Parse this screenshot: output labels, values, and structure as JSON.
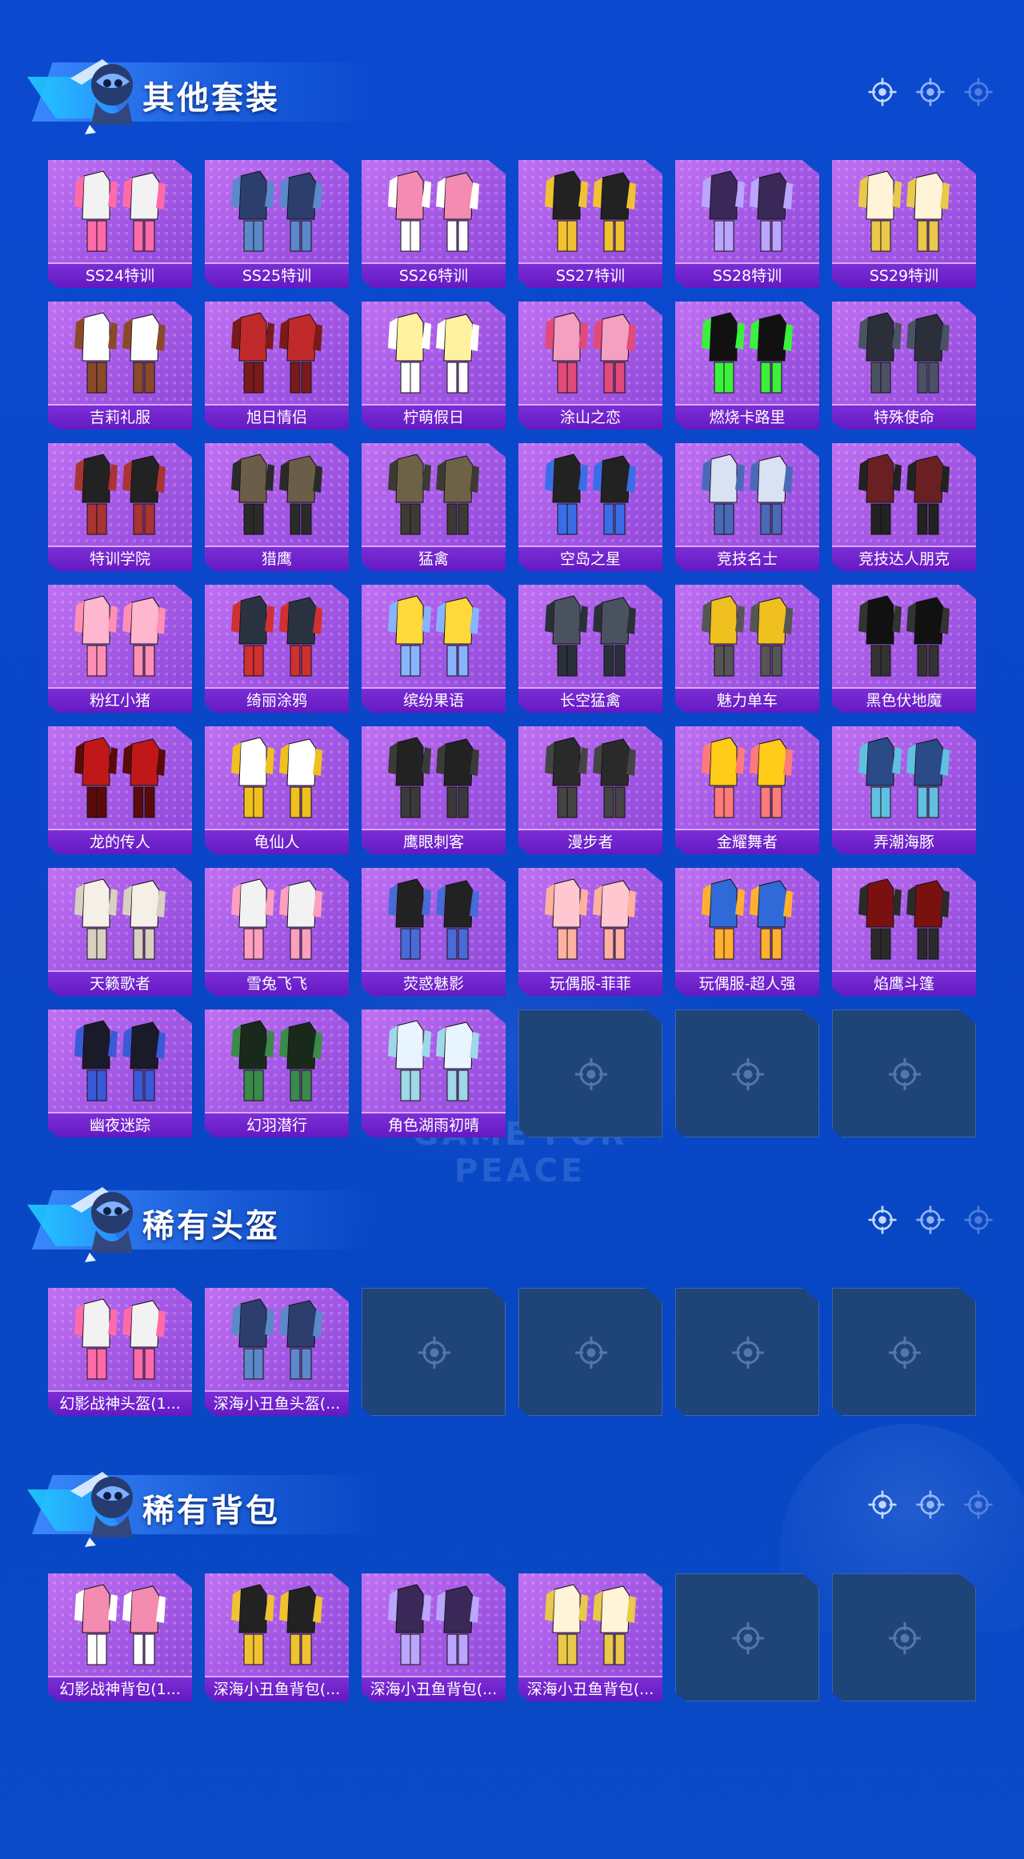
{
  "watermark": "GAME FOR PEACE",
  "sections": [
    {
      "title": "其他套装",
      "items": [
        "SS24特训",
        "SS25特训",
        "SS26特训",
        "SS27特训",
        "SS28特训",
        "SS29特训",
        "吉莉礼服",
        "旭日情侣",
        "柠萌假日",
        "涂山之恋",
        "燃烧卡路里",
        "特殊使命",
        "特训学院",
        "猎鹰",
        "猛禽",
        "空岛之星",
        "竞技名士",
        "竞技达人朋克",
        "粉红小猪",
        "绮丽涂鸦",
        "缤纷果语",
        "长空猛禽",
        "魅力单车",
        "黑色伏地魔",
        "龙的传人",
        "龟仙人",
        "鹰眼刺客",
        "漫步者",
        "金耀舞者",
        "弄潮海豚",
        "天籁歌者",
        "雪兔飞飞",
        "荧惑魅影",
        "玩偶服-菲菲",
        "玩偶服-超人强",
        "焰鹰斗篷",
        "幽夜迷踪",
        "幻羽潜行",
        "角色湖雨初晴"
      ],
      "empty_slots": 3
    },
    {
      "title": "稀有头盔",
      "items": [
        "幻影战神头盔(1...",
        "深海小丑鱼头盔(..."
      ],
      "empty_slots": 4
    },
    {
      "title": "稀有背包",
      "items": [
        "幻影战神背包(1...",
        "深海小丑鱼背包(...",
        "深海小丑鱼背包(...",
        "深海小丑鱼背包(..."
      ],
      "empty_slots": 2
    }
  ],
  "colors": {
    "background": "#0a46c8",
    "card_fill": "#a65ae6",
    "label_bar": "#6419c2",
    "empty_slot": "#1f4478"
  },
  "icons": {
    "header_character": "parachute-soldier-icon",
    "header_deco": "crosshair-icon",
    "empty_slot": "crosshair-icon"
  }
}
